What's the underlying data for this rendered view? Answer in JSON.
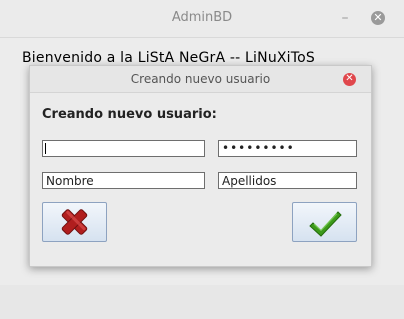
{
  "main_window": {
    "title": "AdminBD",
    "minimize_glyph": "–",
    "close_glyph": "✕",
    "heading": "Bienvenido a la LiStA NeGrA -- LiNuXiToS"
  },
  "dialog": {
    "title": "Creando nuevo usuario",
    "close_glyph": "✕",
    "heading": "Creando nuevo usuario:",
    "fields": {
      "username": {
        "value": ""
      },
      "password": {
        "value": "•••••••••"
      },
      "name": {
        "placeholder": "Nombre"
      },
      "surname": {
        "placeholder": "Apellidos"
      }
    },
    "buttons": {
      "cancel": {
        "icon": "red-x-icon"
      },
      "accept": {
        "icon": "green-check-icon"
      }
    }
  },
  "colors": {
    "close_red": "#e0474c",
    "cancel_icon": "#b01e1e",
    "accept_icon": "#3c9a1a"
  }
}
